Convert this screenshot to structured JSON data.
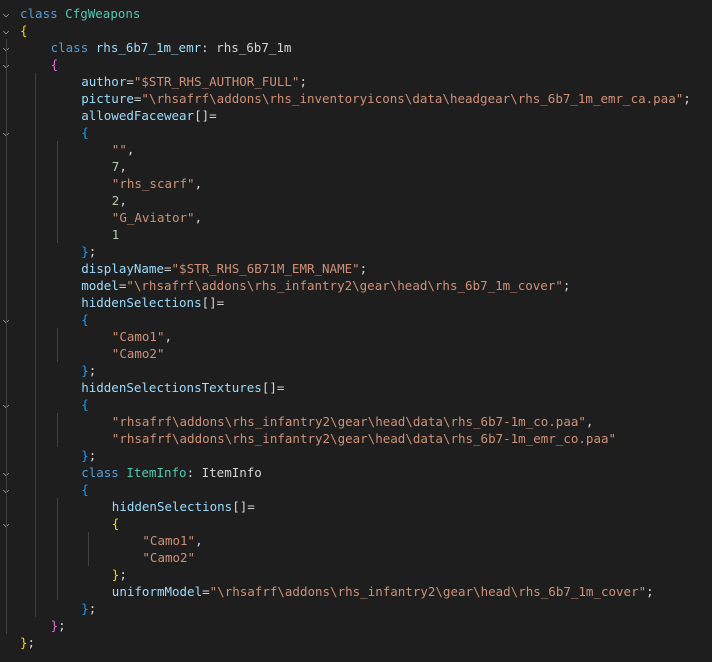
{
  "colors": {
    "background": "#1e1e1e",
    "keyword": "#569cd6",
    "class_name": "#4ec9b0",
    "property": "#9cdcfe",
    "string": "#ce9178",
    "number": "#b5cea8",
    "punctuation": "#d4d4d4"
  },
  "icons": {
    "fold_open": "chevron-down-icon"
  },
  "lines": [
    {
      "indent": 0,
      "fold": true,
      "tokens": [
        [
          "kw",
          "class"
        ],
        [
          "pun",
          " "
        ],
        [
          "cls",
          "CfgWeapons"
        ]
      ]
    },
    {
      "indent": 0,
      "fold": true,
      "tokens": [
        [
          "brace",
          "{"
        ]
      ]
    },
    {
      "indent": 1,
      "fold": true,
      "tokens": [
        [
          "kw",
          "class"
        ],
        [
          "pun",
          " "
        ],
        [
          "prop",
          "rhs_6b7_1m_emr"
        ],
        [
          "pun",
          ": rhs_6b7_1m"
        ]
      ]
    },
    {
      "indent": 1,
      "fold": true,
      "tokens": [
        [
          "brace2",
          "{"
        ]
      ]
    },
    {
      "indent": 2,
      "fold": false,
      "tokens": [
        [
          "prop",
          "author"
        ],
        [
          "pun",
          "="
        ],
        [
          "str",
          "\"$STR_RHS_AUTHOR_FULL\""
        ],
        [
          "pun",
          ";"
        ]
      ]
    },
    {
      "indent": 2,
      "fold": false,
      "tokens": [
        [
          "prop",
          "picture"
        ],
        [
          "pun",
          "="
        ],
        [
          "str",
          "\"\\rhsafrf\\addons\\rhs_inventoryicons\\data\\headgear\\rhs_6b7_1m_emr_ca.paa\""
        ],
        [
          "pun",
          ";"
        ]
      ]
    },
    {
      "indent": 2,
      "fold": false,
      "tokens": [
        [
          "prop",
          "allowedFacewear"
        ],
        [
          "pun",
          "[]="
        ]
      ]
    },
    {
      "indent": 2,
      "fold": true,
      "tokens": [
        [
          "brace3",
          "{"
        ]
      ]
    },
    {
      "indent": 3,
      "fold": false,
      "tokens": [
        [
          "str",
          "\"\""
        ],
        [
          "pun",
          ","
        ]
      ]
    },
    {
      "indent": 3,
      "fold": false,
      "tokens": [
        [
          "num",
          "7"
        ],
        [
          "pun",
          ","
        ]
      ]
    },
    {
      "indent": 3,
      "fold": false,
      "tokens": [
        [
          "str",
          "\"rhs_scarf\""
        ],
        [
          "pun",
          ","
        ]
      ]
    },
    {
      "indent": 3,
      "fold": false,
      "tokens": [
        [
          "num",
          "2"
        ],
        [
          "pun",
          ","
        ]
      ]
    },
    {
      "indent": 3,
      "fold": false,
      "tokens": [
        [
          "str",
          "\"G_Aviator\""
        ],
        [
          "pun",
          ","
        ]
      ]
    },
    {
      "indent": 3,
      "fold": false,
      "tokens": [
        [
          "num",
          "1"
        ]
      ]
    },
    {
      "indent": 2,
      "fold": false,
      "tokens": [
        [
          "brace3",
          "}"
        ],
        [
          "pun",
          ";"
        ]
      ]
    },
    {
      "indent": 2,
      "fold": false,
      "tokens": [
        [
          "prop",
          "displayName"
        ],
        [
          "pun",
          "="
        ],
        [
          "str",
          "\"$STR_RHS_6B71M_EMR_NAME\""
        ],
        [
          "pun",
          ";"
        ]
      ]
    },
    {
      "indent": 2,
      "fold": false,
      "tokens": [
        [
          "prop",
          "model"
        ],
        [
          "pun",
          "="
        ],
        [
          "str",
          "\"\\rhsafrf\\addons\\rhs_infantry2\\gear\\head\\rhs_6b7_1m_cover\""
        ],
        [
          "pun",
          ";"
        ]
      ]
    },
    {
      "indent": 2,
      "fold": false,
      "tokens": [
        [
          "prop",
          "hiddenSelections"
        ],
        [
          "pun",
          "[]="
        ]
      ]
    },
    {
      "indent": 2,
      "fold": true,
      "tokens": [
        [
          "brace3",
          "{"
        ]
      ]
    },
    {
      "indent": 3,
      "fold": false,
      "tokens": [
        [
          "str",
          "\"Camo1\""
        ],
        [
          "pun",
          ","
        ]
      ]
    },
    {
      "indent": 3,
      "fold": false,
      "tokens": [
        [
          "str",
          "\"Camo2\""
        ]
      ]
    },
    {
      "indent": 2,
      "fold": false,
      "tokens": [
        [
          "brace3",
          "}"
        ],
        [
          "pun",
          ";"
        ]
      ]
    },
    {
      "indent": 2,
      "fold": false,
      "tokens": [
        [
          "prop",
          "hiddenSelectionsTextures"
        ],
        [
          "pun",
          "[]="
        ]
      ]
    },
    {
      "indent": 2,
      "fold": true,
      "tokens": [
        [
          "brace3",
          "{"
        ]
      ]
    },
    {
      "indent": 3,
      "fold": false,
      "tokens": [
        [
          "str",
          "\"rhsafrf\\addons\\rhs_infantry2\\gear\\head\\data\\rhs_6b7-1m_co.paa\""
        ],
        [
          "pun",
          ","
        ]
      ]
    },
    {
      "indent": 3,
      "fold": false,
      "tokens": [
        [
          "str",
          "\"rhsafrf\\addons\\rhs_infantry2\\gear\\head\\data\\rhs_6b7-1m_emr_co.paa\""
        ]
      ]
    },
    {
      "indent": 2,
      "fold": false,
      "tokens": [
        [
          "brace3",
          "}"
        ],
        [
          "pun",
          ";"
        ]
      ]
    },
    {
      "indent": 2,
      "fold": true,
      "tokens": [
        [
          "kw",
          "class"
        ],
        [
          "pun",
          " "
        ],
        [
          "cls",
          "ItemInfo"
        ],
        [
          "pun",
          ": ItemInfo"
        ]
      ]
    },
    {
      "indent": 2,
      "fold": true,
      "tokens": [
        [
          "brace3",
          "{"
        ]
      ]
    },
    {
      "indent": 3,
      "fold": false,
      "tokens": [
        [
          "prop",
          "hiddenSelections"
        ],
        [
          "pun",
          "[]="
        ]
      ]
    },
    {
      "indent": 3,
      "fold": true,
      "tokens": [
        [
          "brace",
          "{"
        ]
      ]
    },
    {
      "indent": 4,
      "fold": false,
      "tokens": [
        [
          "str",
          "\"Camo1\""
        ],
        [
          "pun",
          ","
        ]
      ]
    },
    {
      "indent": 4,
      "fold": false,
      "tokens": [
        [
          "str",
          "\"Camo2\""
        ]
      ]
    },
    {
      "indent": 3,
      "fold": false,
      "tokens": [
        [
          "brace",
          "}"
        ],
        [
          "pun",
          ";"
        ]
      ]
    },
    {
      "indent": 3,
      "fold": false,
      "tokens": [
        [
          "prop",
          "uniformModel"
        ],
        [
          "pun",
          "="
        ],
        [
          "str",
          "\"\\rhsafrf\\addons\\rhs_infantry2\\gear\\head\\rhs_6b7_1m_cover\""
        ],
        [
          "pun",
          ";"
        ]
      ]
    },
    {
      "indent": 2,
      "fold": false,
      "tokens": [
        [
          "brace3",
          "}"
        ],
        [
          "pun",
          ";"
        ]
      ]
    },
    {
      "indent": 1,
      "fold": false,
      "tokens": [
        [
          "brace2",
          "}"
        ],
        [
          "pun",
          ";"
        ]
      ]
    },
    {
      "indent": 0,
      "fold": false,
      "tokens": [
        [
          "brace",
          "}"
        ],
        [
          "pun",
          ";"
        ]
      ]
    }
  ]
}
